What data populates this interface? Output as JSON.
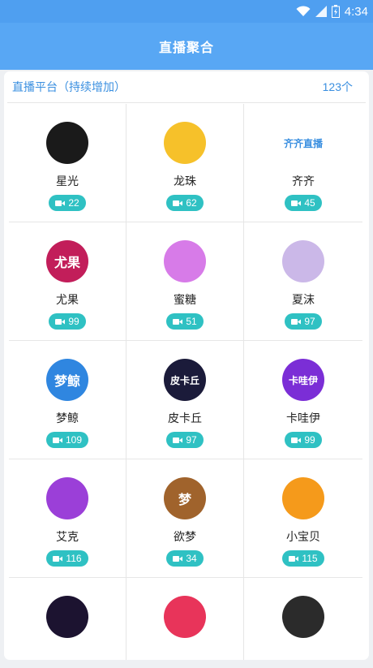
{
  "status": {
    "time": "4:34"
  },
  "header": {
    "title": "直播聚合"
  },
  "section": {
    "title": "直播平台（持续增加）",
    "count": "123个"
  },
  "platforms": [
    {
      "name": "星光",
      "count": "22",
      "color": "#1a1a1a",
      "icon": "star-light-logo"
    },
    {
      "name": "龙珠",
      "count": "62",
      "color": "#f6c12a",
      "icon": "dragon-logo"
    },
    {
      "name": "齐齐",
      "count": "45",
      "color": "#ffffff",
      "icon": "bear-logo",
      "logo_text": "齐齐直播"
    },
    {
      "name": "尤果",
      "count": "99",
      "color": "#c21e5a",
      "icon": "youguo-logo",
      "logo_text": "尤果"
    },
    {
      "name": "蜜糖",
      "count": "51",
      "color": "#d77be8",
      "icon": "sugar-logo"
    },
    {
      "name": "夏沫",
      "count": "97",
      "color": "#cbb8e8",
      "icon": "xiamo-logo"
    },
    {
      "name": "梦鲸",
      "count": "109",
      "color": "#2f86e0",
      "icon": "whale-logo",
      "logo_text": "梦鲸"
    },
    {
      "name": "皮卡丘",
      "count": "97",
      "color": "#1b1b3a",
      "icon": "pikachu-logo",
      "logo_text": "皮卡丘"
    },
    {
      "name": "卡哇伊",
      "count": "99",
      "color": "#7b2ed6",
      "icon": "kawayi-logo",
      "logo_text": "卡哇伊"
    },
    {
      "name": "艾克",
      "count": "116",
      "color": "#9b3fd8",
      "icon": "aike-logo"
    },
    {
      "name": "欲梦",
      "count": "34",
      "color": "#a0632c",
      "icon": "yumeng-logo",
      "logo_text": "梦"
    },
    {
      "name": "小宝贝",
      "count": "115",
      "color": "#f59a1b",
      "icon": "baby-logo"
    },
    {
      "name": "",
      "count": "",
      "color": "#1c1330",
      "icon": "night-logo"
    },
    {
      "name": "",
      "count": "",
      "color": "#e8345a",
      "icon": "lightning-logo"
    },
    {
      "name": "",
      "count": "",
      "color": "#2b2b2b",
      "icon": "dancer-logo"
    }
  ]
}
